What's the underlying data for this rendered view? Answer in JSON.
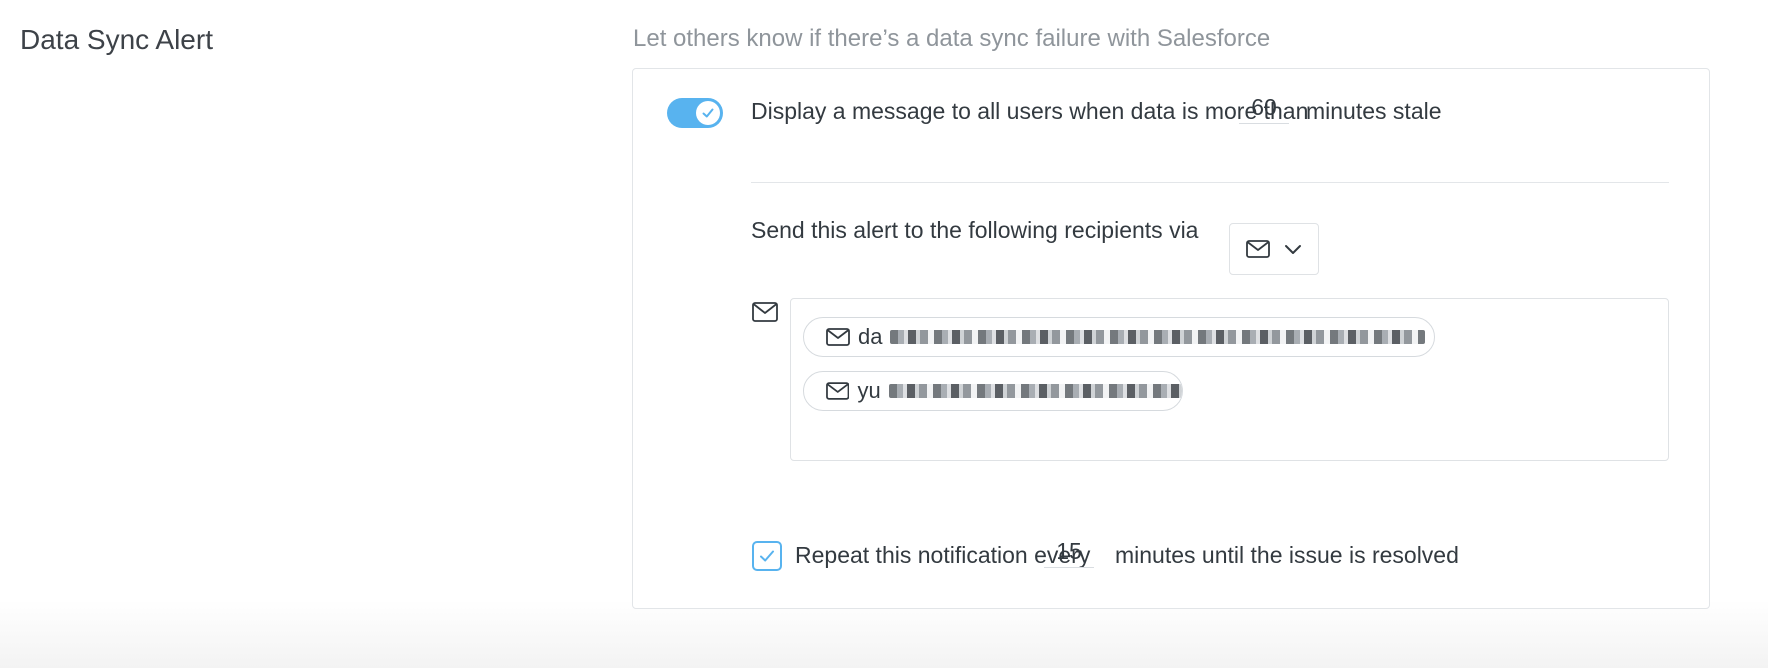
{
  "section": {
    "title": "Data Sync Alert",
    "description": "Let others know if there’s a data sync failure with Salesforce"
  },
  "stale_message": {
    "enabled": true,
    "prefix": "Display a message to all users when data is more than",
    "minutes": "60",
    "suffix": "minutes stale"
  },
  "recipients": {
    "label": "Send this alert to the following recipients via",
    "channel_icon": "mail-icon",
    "list": [
      {
        "visible_prefix": "da"
      },
      {
        "visible_prefix": "yu"
      }
    ]
  },
  "repeat": {
    "checked": true,
    "prefix": "Repeat this notification every",
    "minutes": "15",
    "suffix": "minutes until the issue is resolved"
  },
  "colors": {
    "accent": "#58b3ef",
    "text": "#333a40",
    "muted": "#8f959b",
    "border": "#dfe2e5"
  }
}
